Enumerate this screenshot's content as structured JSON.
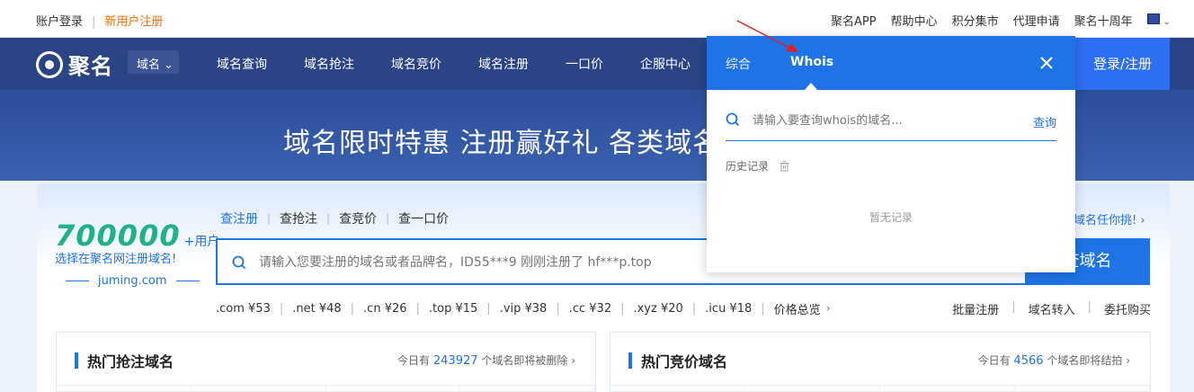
{
  "topbar": {
    "login": "账户登录",
    "separator": "|",
    "register": "新用户注册",
    "links": [
      "聚名APP",
      "帮助中心",
      "积分集市",
      "代理申请",
      "聚名十周年"
    ]
  },
  "nav": {
    "logo_text": "聚名",
    "domain_select": "域名",
    "items": [
      "域名查询",
      "域名抢注",
      "域名竞价",
      "域名注册",
      "一口价",
      "企服中心"
    ],
    "login_button": "登录/注册"
  },
  "hero": {
    "title": "域名限时特惠 注册赢好礼 各类域名层"
  },
  "promo": {
    "number": "700000",
    "plus": "+用户",
    "subtitle": "选择在聚名网注册域名!",
    "site": "juming.com",
    "right_text": "域名任你挑! ›"
  },
  "search": {
    "tabs": [
      "查注册",
      "查抢注",
      "查竞价",
      "查一口价"
    ],
    "placeholder": "请输入您要注册的域名或者品牌名，ID55***9 刚刚注册了 hf***p.top",
    "button": "查域名"
  },
  "prices": {
    "items": [
      ".com ¥53",
      ".net ¥48",
      ".cn ¥26",
      ".top ¥15",
      ".vip ¥38",
      ".cc ¥32",
      ".xyz ¥20",
      ".icu ¥18"
    ],
    "overview": "价格总览"
  },
  "quick_links": [
    "批量注册",
    "域名转入",
    "委托购买"
  ],
  "panels": [
    {
      "title": "热门抢注域名",
      "prefix": "今日有",
      "count": "243927",
      "suffix": "个域名即将被删除"
    },
    {
      "title": "热门竞价域名",
      "prefix": "今日有",
      "count": "4566",
      "suffix": "个域名即将结拍"
    }
  ],
  "popup": {
    "tab1": "综合",
    "tab2": "Whois",
    "placeholder": "请输入要查询whois的域名...",
    "query_button": "查询",
    "history_label": "历史记录",
    "empty_text": "暂无记录"
  },
  "colors": {
    "primary": "#1e73e6",
    "nav_bg": "#2a4485",
    "accent_orange": "#ff6a00",
    "promo_green": "#20b08a",
    "annotation_red": "#e02020"
  }
}
